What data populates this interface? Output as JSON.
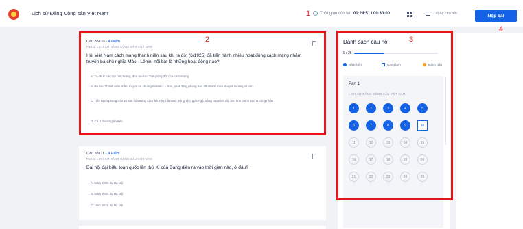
{
  "header": {
    "app_title": "Lịch sử Đảng Cộng sản Việt Nam",
    "timer_label": "Thời gian còn lại:",
    "timer_value": "00:24:51 / 00:30:00",
    "list_label": "Tất cả câu hỏi",
    "submit_label": "Nộp bài"
  },
  "annotations": [
    "1",
    "2",
    "3",
    "4"
  ],
  "questions": [
    {
      "title": "Câu hỏi 10",
      "points": "- 4 Điểm",
      "part": "Part 1: LỊCH SỬ ĐẢNG CỘNG SẢN VIỆT NAM",
      "text": "Hội Việt Nam cách mạng thanh niên sau khi ra đời (6/1925) đã tiến hành nhiều hoạt động cách mạng nhằm truyền bá chủ nghĩa Mác - Lênin, nổi bật là những hoạt động nào?",
      "options": [
        "A. Tổ chức các lớp bồi dưỡng, đào tạo các \"hạt giống đỏ\" của cách mạng",
        "B. Ra báo Thanh niên nhằm truyền bá chủ nghĩa Mác - Lênin, phát động phong trào đấu tranh theo khuynh hướng vô sản",
        "C. Tiến hành phong trào vô sản hóa trong các nhà máy, hầm mỏ, xí nghiệp, giác ngộ, nâng cao trình độ, bản lĩnh chính trị cho công nhân",
        "D. Cả 3 phương án trên"
      ]
    },
    {
      "title": "Câu hỏi 11",
      "points": "- 4 Điểm",
      "part": "Part 1: LỊCH SỬ ĐẢNG CỘNG SẢN VIỆT NAM",
      "text": "Đại hội đại biểu toàn quốc lần thứ XI của Đảng diễn ra vào thời gian nào, ở đâu?",
      "options": [
        "A. Năm 2009, tại Hà Nội",
        "B. Năm 2010, tại Hà Nội",
        "C. Năm 2011, tại Hà Nội"
      ]
    }
  ],
  "panel": {
    "title": "Danh sách câu hỏi",
    "progress_text": "9 / 25",
    "progress_fraction": 0.36,
    "legend": [
      "Đã trả lời",
      "Đang làm",
      "Đánh dấu"
    ],
    "legend_colors": [
      "#1463e6",
      "#1463e6",
      "#f59e24"
    ],
    "part_title": "Part 1",
    "part_subtitle": "LỊCH SỬ ĐẢNG CỘNG SẢN VIỆT NAM",
    "buttons": [
      {
        "label": "1",
        "state": "done"
      },
      {
        "label": "2",
        "state": "done"
      },
      {
        "label": "3",
        "state": "done"
      },
      {
        "label": "4",
        "state": "done"
      },
      {
        "label": "5",
        "state": "done"
      },
      {
        "label": "6",
        "state": "done"
      },
      {
        "label": "7",
        "state": "done"
      },
      {
        "label": "8",
        "state": "done"
      },
      {
        "label": "9",
        "state": "done"
      },
      {
        "label": "10",
        "state": "current"
      },
      {
        "label": "11",
        "state": "todo"
      },
      {
        "label": "12",
        "state": "todo"
      },
      {
        "label": "13",
        "state": "todo"
      },
      {
        "label": "14",
        "state": "todo"
      },
      {
        "label": "15",
        "state": "todo"
      },
      {
        "label": "16",
        "state": "todo"
      },
      {
        "label": "17",
        "state": "todo"
      },
      {
        "label": "18",
        "state": "todo"
      },
      {
        "label": "19",
        "state": "todo"
      },
      {
        "label": "20",
        "state": "todo"
      },
      {
        "label": "21",
        "state": "todo"
      },
      {
        "label": "22",
        "state": "todo"
      },
      {
        "label": "23",
        "state": "todo"
      },
      {
        "label": "24",
        "state": "todo"
      },
      {
        "label": "25",
        "state": "todo"
      }
    ]
  },
  "colors": {
    "accent": "#1463e6",
    "annotation_red": "#e8141a",
    "background": "#f1f2f6"
  },
  "icons": [
    "logo-icon",
    "clock-icon",
    "grid-icon",
    "list-icon",
    "flag-icon"
  ]
}
